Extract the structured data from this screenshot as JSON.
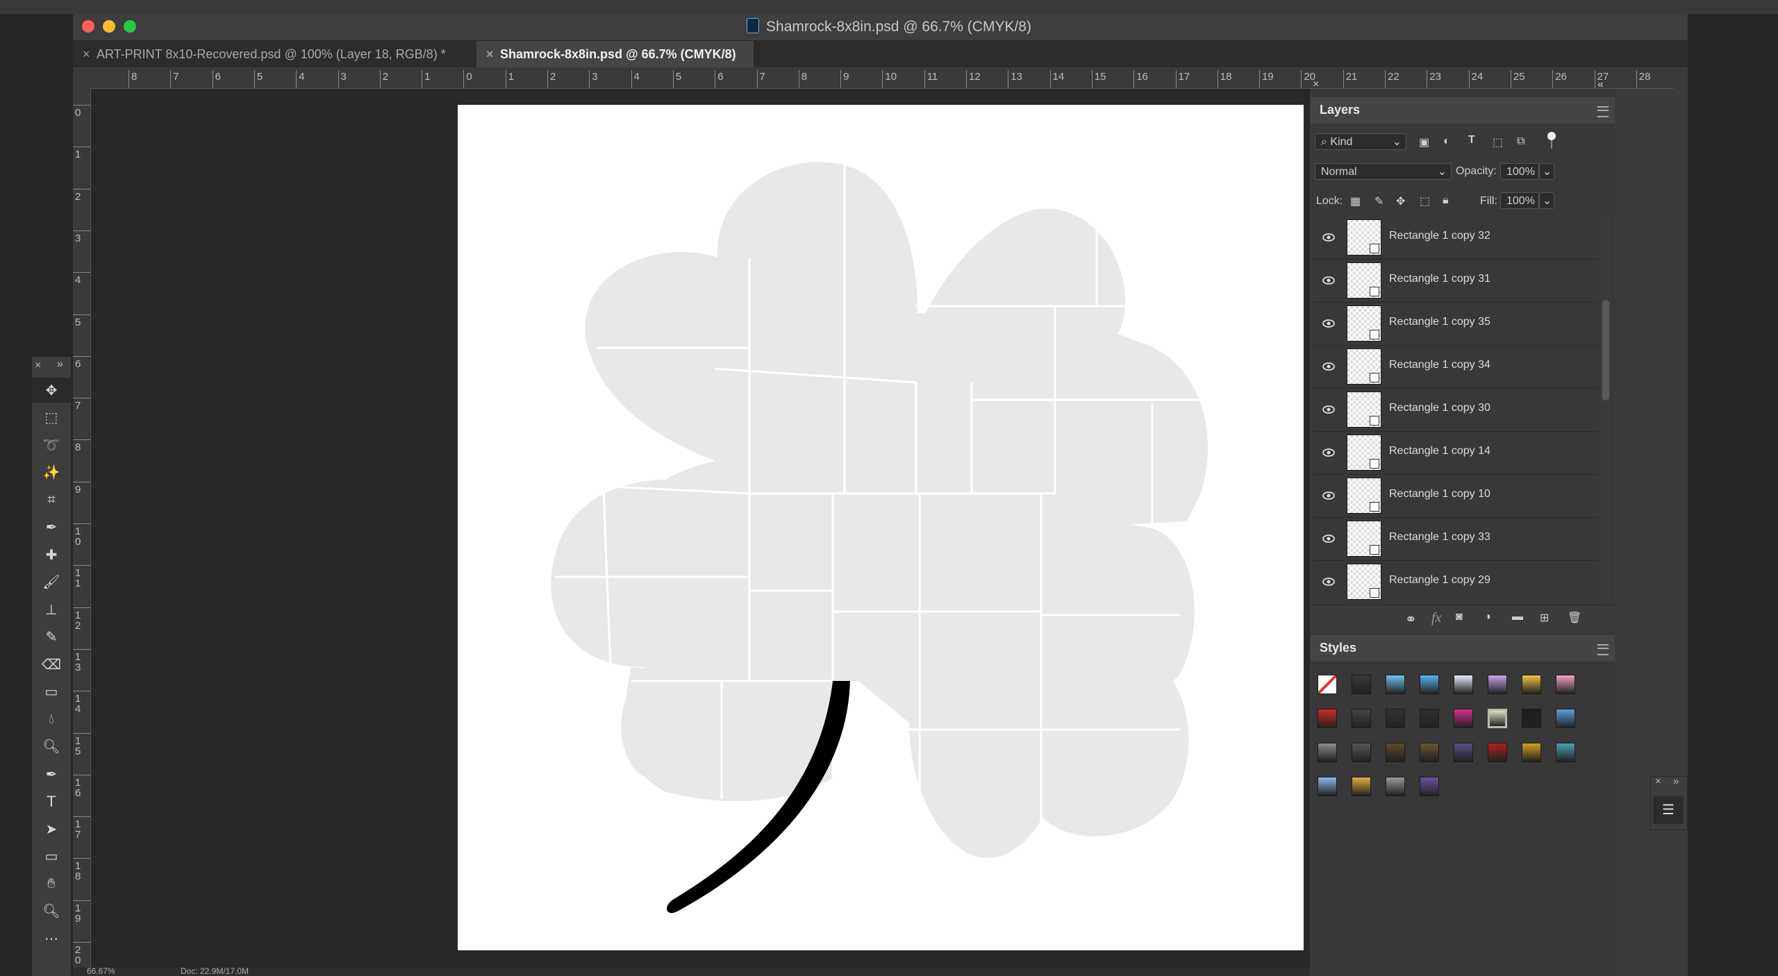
{
  "window": {
    "title": "Shamrock-8x8in.psd @ 66.7% (CMYK/8)",
    "title_icon": "photoshop-doc-icon"
  },
  "tabs": [
    {
      "label": "ART-PRINT 8x10-Recovered.psd @ 100% (Layer 18, RGB/8) *",
      "active": false
    },
    {
      "label": "Shamrock-8x8in.psd @ 66.7% (CMYK/8)",
      "active": true
    }
  ],
  "ruler": {
    "h_labels": [
      "8",
      "7",
      "6",
      "5",
      "4",
      "3",
      "2",
      "1",
      "0",
      "1",
      "2",
      "3",
      "4",
      "5",
      "6",
      "7",
      "8",
      "9",
      "10",
      "11",
      "12",
      "13",
      "14",
      "15",
      "16",
      "17",
      "18",
      "19",
      "20",
      "21",
      "22",
      "23",
      "24",
      "25",
      "26",
      "27",
      "28"
    ],
    "v_labels": [
      "0",
      "1",
      "2",
      "3",
      "4",
      "5",
      "6",
      "7",
      "8",
      "9",
      "1\n0",
      "1\n1",
      "1\n2",
      "1\n3",
      "1\n4",
      "1\n5",
      "1\n6",
      "1\n7",
      "1\n8",
      "1\n9",
      "2\n0"
    ]
  },
  "tools": [
    "move-tool",
    "marquee-tool",
    "lasso-tool",
    "magic-wand-tool",
    "crop-tool",
    "eyedropper-tool",
    "healing-brush-tool",
    "brush-tool",
    "clone-stamp-tool",
    "history-brush-tool",
    "eraser-tool",
    "gradient-tool",
    "blur-tool",
    "dodge-tool",
    "pen-tool",
    "type-tool",
    "path-selection-tool",
    "rectangle-tool",
    "hand-tool",
    "zoom-tool",
    "more-tools"
  ],
  "layers_panel": {
    "title": "Layers",
    "filter": "Kind",
    "blend_mode": "Normal",
    "opacity_label": "Opacity:",
    "opacity": "100%",
    "lock_label": "Lock:",
    "fill_label": "Fill:",
    "fill": "100%",
    "layers": [
      "Rectangle 1 copy 32",
      "Rectangle 1 copy 31",
      "Rectangle 1 copy 35",
      "Rectangle 1 copy 34",
      "Rectangle 1 copy 30",
      "Rectangle 1 copy 14",
      "Rectangle 1 copy 10",
      "Rectangle 1 copy 33",
      "Rectangle 1 copy 29"
    ]
  },
  "styles_panel": {
    "title": "Styles",
    "swatches": [
      "#ffffff",
      "#3a3a3a",
      "#6ec3f5",
      "#56b4ef",
      "#e6eef8",
      "#c9a3ef",
      "#f3c542",
      "#f6a3c7",
      "#d32a2a",
      "#444444",
      "#333333",
      "#2f2f2f",
      "#d62f8a",
      "#dcdcc8",
      "#1e1e1e",
      "#5aa0d8",
      "#8a8a8a",
      "#575757",
      "#5a4a2a",
      "#6a5432",
      "#5a4f8a",
      "#b02020",
      "#d4a020",
      "#4aa0b0",
      "#8fb8e8",
      "#e0b040",
      "#9a9a9a",
      "#7050a0"
    ]
  },
  "status": {
    "zoom": "66.67%",
    "doc": "Doc: 22.9M/17.0M"
  }
}
